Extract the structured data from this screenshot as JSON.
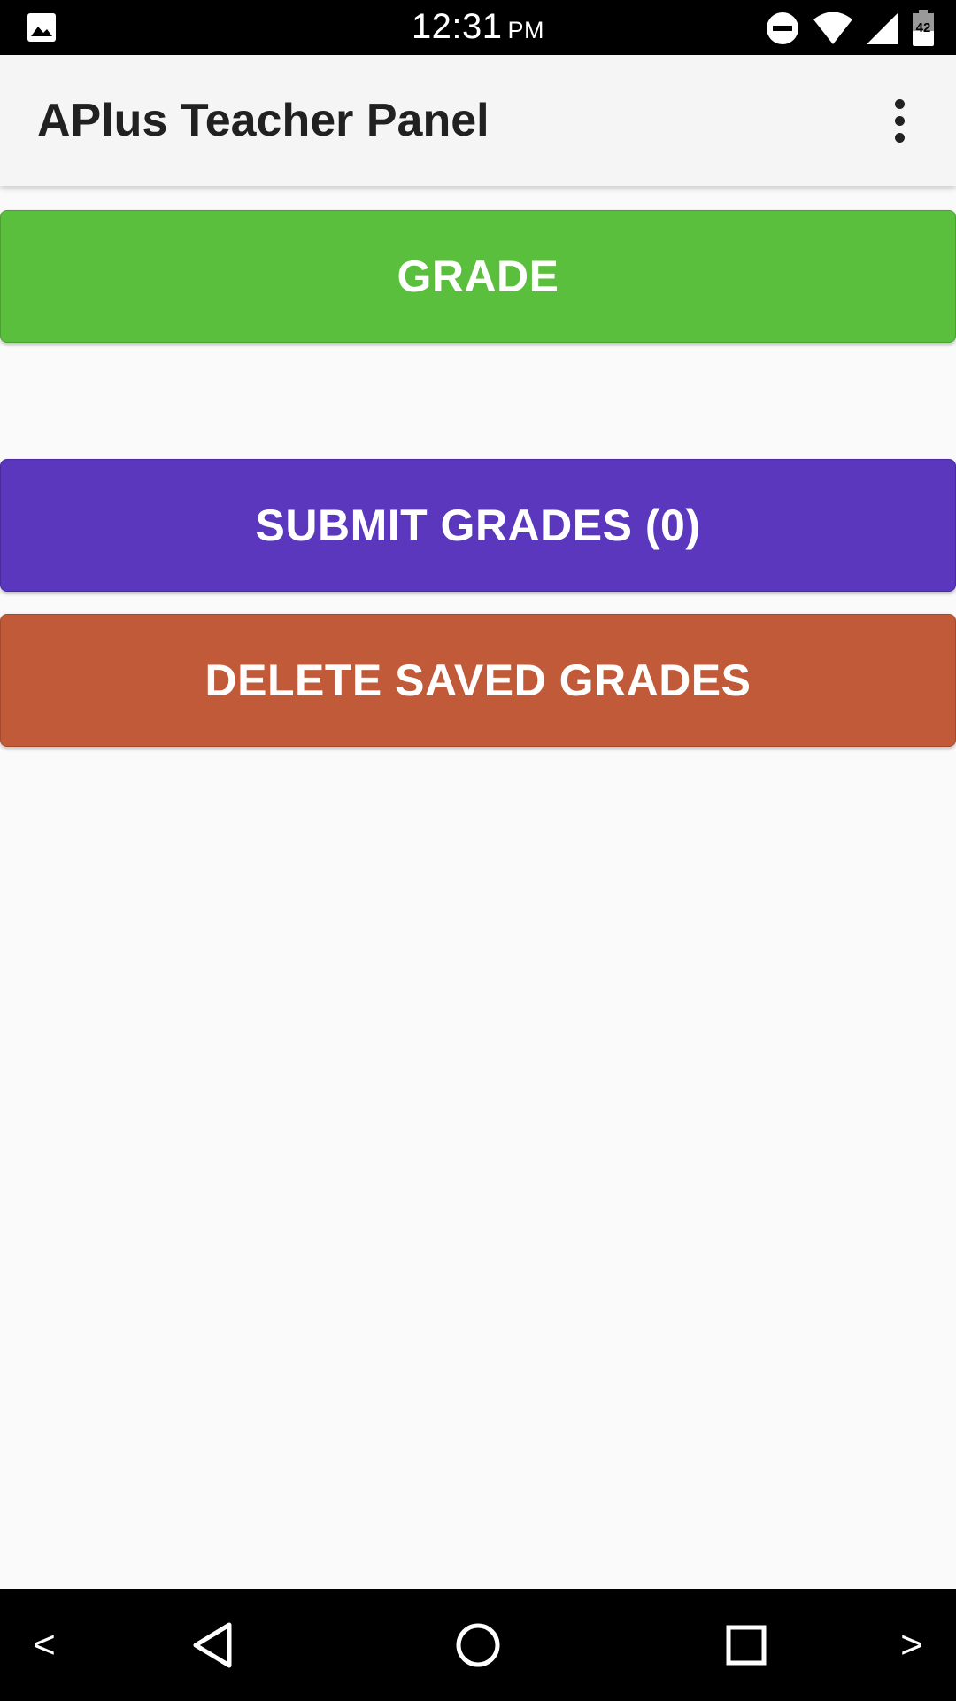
{
  "status_bar": {
    "time": "12:31",
    "ampm": "PM",
    "battery_level": "42",
    "left_icon": "image-icon",
    "right_icons": [
      "do-not-disturb-icon",
      "wifi-icon",
      "cellular-signal-icon",
      "battery-icon"
    ]
  },
  "app_bar": {
    "title": "APlus Teacher Panel",
    "menu_icon": "more-vertical-icon"
  },
  "buttons": {
    "grade": "GRADE",
    "submit": "SUBMIT GRADES (0)",
    "delete": "DELETE SAVED GRADES"
  },
  "colors": {
    "grade_button": "#5abf3c",
    "submit_button": "#5b37bd",
    "delete_button": "#c05a38",
    "app_bar": "#f5f5f5",
    "background": "#fafafa"
  },
  "nav_bar": {
    "prev_label": "<",
    "next_label": ">",
    "icons": [
      "back-icon",
      "home-icon",
      "recents-icon"
    ]
  }
}
